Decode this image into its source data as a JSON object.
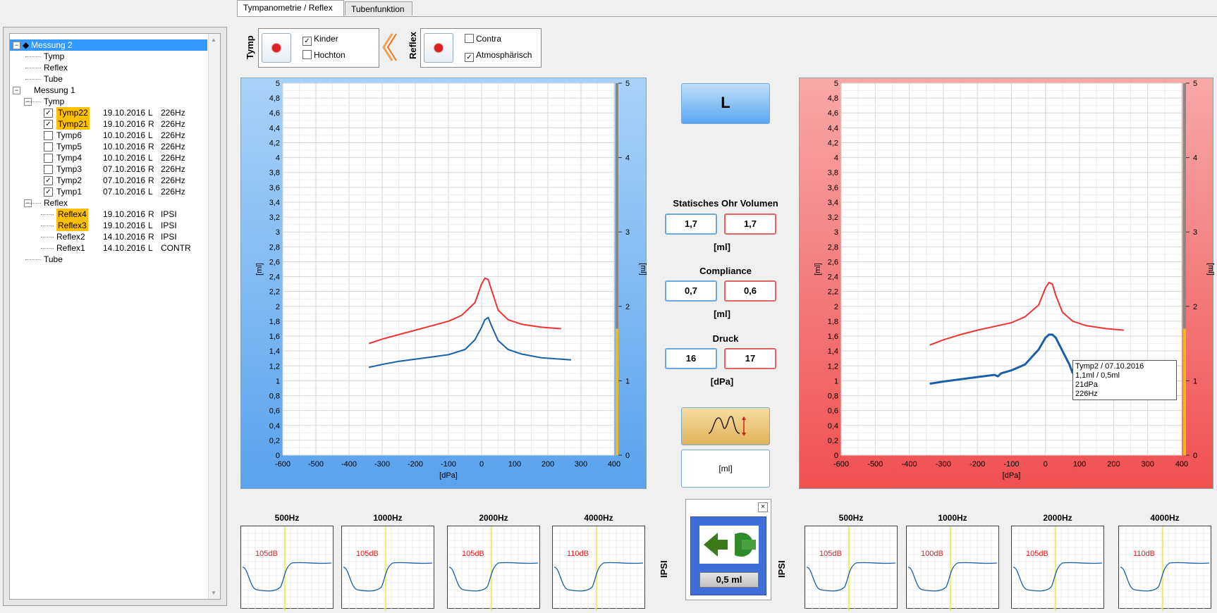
{
  "tabs": [
    "Tympanometrie / Reflex",
    "Tubenfunktion"
  ],
  "tree": {
    "rows": [
      {
        "label": "Messung 2",
        "level": 0,
        "expander": "−",
        "selected": true,
        "diamond": true
      },
      {
        "label": "Tymp",
        "level": 2
      },
      {
        "label": "Reflex",
        "level": 2
      },
      {
        "label": "Tube",
        "level": 2
      },
      {
        "label": "Messung 1",
        "level": 1,
        "expander": "−"
      },
      {
        "label": "Tymp",
        "level": 2,
        "expander": "−"
      },
      {
        "label": "Tymp22",
        "level": 3,
        "checked": true,
        "highlight": true,
        "date": "19.10.2016",
        "side": "L",
        "info": "226Hz"
      },
      {
        "label": "Tymp21",
        "level": 3,
        "checked": true,
        "highlight": true,
        "date": "19.10.2016",
        "side": "R",
        "info": "226Hz"
      },
      {
        "label": "Tymp6",
        "level": 3,
        "checked": false,
        "date": "10.10.2016",
        "side": "L",
        "info": "226Hz"
      },
      {
        "label": "Tymp5",
        "level": 3,
        "checked": false,
        "date": "10.10.2016",
        "side": "R",
        "info": "226Hz"
      },
      {
        "label": "Tymp4",
        "level": 3,
        "checked": false,
        "date": "10.10.2016",
        "side": "L",
        "info": "226Hz"
      },
      {
        "label": "Tymp3",
        "level": 3,
        "checked": false,
        "date": "07.10.2016",
        "side": "R",
        "info": "226Hz"
      },
      {
        "label": "Tymp2",
        "level": 3,
        "checked": true,
        "date": "07.10.2016",
        "side": "R",
        "info": "226Hz"
      },
      {
        "label": "Tymp1",
        "level": 3,
        "checked": true,
        "date": "07.10.2016",
        "side": "L",
        "info": "226Hz"
      },
      {
        "label": "Reflex",
        "level": 2,
        "expander": "−"
      },
      {
        "label": "Reflex4",
        "level": 3,
        "highlight": true,
        "date": "19.10.2016",
        "side": "R",
        "info": "IPSI"
      },
      {
        "label": "Reflex3",
        "level": 3,
        "highlight": true,
        "date": "19.10.2016",
        "side": "L",
        "info": "IPSI"
      },
      {
        "label": "Reflex2",
        "level": 3,
        "date": "14.10.2016",
        "side": "R",
        "info": "IPSI"
      },
      {
        "label": "Reflex1",
        "level": 3,
        "date": "14.10.2016",
        "side": "L",
        "info": "CONTR"
      },
      {
        "label": "Tube",
        "level": 2
      }
    ]
  },
  "tymp_group": {
    "title": "Tymp",
    "kinder": "Kinder",
    "kinder_checked": true,
    "hochton": "Hochton",
    "hochton_checked": false
  },
  "reflex_group": {
    "title": "Reflex",
    "contra": "Contra",
    "contra_checked": false,
    "atmos": "Atmosphärisch",
    "atmos_checked": true
  },
  "ear_button": "L",
  "measures": {
    "volume_title": "Statisches Ohr Volumen",
    "volume_left": "1,7",
    "volume_right": "1,7",
    "volume_unit": "[ml]",
    "compliance_title": "Compliance",
    "compliance_left": "0,7",
    "compliance_right": "0,6",
    "compliance_unit": "[ml]",
    "druck_title": "Druck",
    "druck_left": "16",
    "druck_right": "17",
    "druck_unit": "[dPa]"
  },
  "ml_button": "[ml]",
  "ipsi_box": {
    "value": "0,5 ml",
    "left_label": "IPSI",
    "right_label": "IPSI"
  },
  "colors": {
    "left_panel": "#7db8f0",
    "right_panel": "#f27070",
    "curve_red": "#ee3333",
    "curve_blue": "#1a5fa8",
    "marker": "#f0b820"
  },
  "tooltip": {
    "line1": "Tymp2 / 07.10.2016",
    "line2": "1,1ml / 0,5ml",
    "line3": "21dPa",
    "line4": "226Hz"
  },
  "chart_data": [
    {
      "type": "line",
      "name": "left-tympanogram",
      "xlabel": "[dPa]",
      "ylabel": "[ml]",
      "ylabel_right": "[ml]",
      "xlim": [
        -600,
        400
      ],
      "ylim": [
        0,
        5
      ],
      "xticks": [
        "-600",
        "-500",
        "-400",
        "-300",
        "-200",
        "-100",
        "0",
        "100",
        "200",
        "300",
        "400"
      ],
      "yticks": [
        "0",
        "0,2",
        "0,4",
        "0,6",
        "0,8",
        "1",
        "1,2",
        "1,4",
        "1,6",
        "1,8",
        "2",
        "2,2",
        "2,4",
        "2,6",
        "2,8",
        "3",
        "3,2",
        "3,4",
        "3,6",
        "3,8",
        "4",
        "4,2",
        "4,4",
        "4,6",
        "4,8",
        "5"
      ],
      "yticks_right": [
        "0",
        "1",
        "2",
        "3",
        "4",
        "5"
      ],
      "series": [
        {
          "color": "#ee3333",
          "x": [
            -340,
            -300,
            -250,
            -200,
            -150,
            -100,
            -60,
            -20,
            0,
            10,
            20,
            30,
            50,
            80,
            120,
            180,
            240
          ],
          "y": [
            1.5,
            1.56,
            1.62,
            1.68,
            1.74,
            1.8,
            1.88,
            2.05,
            2.3,
            2.38,
            2.36,
            2.22,
            1.95,
            1.82,
            1.76,
            1.72,
            1.7
          ]
        },
        {
          "color": "#1a5fa8",
          "x": [
            -340,
            -300,
            -250,
            -200,
            -150,
            -100,
            -50,
            -20,
            0,
            10,
            20,
            30,
            50,
            80,
            120,
            180,
            270
          ],
          "y": [
            1.18,
            1.22,
            1.26,
            1.29,
            1.32,
            1.35,
            1.42,
            1.55,
            1.72,
            1.82,
            1.85,
            1.74,
            1.54,
            1.42,
            1.36,
            1.31,
            1.28
          ]
        }
      ]
    },
    {
      "type": "line",
      "name": "right-tympanogram",
      "xlabel": "[dPa]",
      "ylabel": "[ml]",
      "ylabel_right": "[ml]",
      "xlim": [
        -600,
        400
      ],
      "ylim": [
        0,
        5
      ],
      "xticks": [
        "-600",
        "-500",
        "-400",
        "-300",
        "-200",
        "-100",
        "0",
        "100",
        "200",
        "300",
        "400"
      ],
      "yticks": [
        "0",
        "0,2",
        "0,4",
        "0,6",
        "0,8",
        "1",
        "1,2",
        "1,4",
        "1,6",
        "1,8",
        "2",
        "2,2",
        "2,4",
        "2,6",
        "2,8",
        "3",
        "3,2",
        "3,4",
        "3,6",
        "3,8",
        "4",
        "4,2",
        "4,4",
        "4,6",
        "4,8",
        "5"
      ],
      "yticks_right": [
        "0",
        "1",
        "2",
        "3",
        "4",
        "5"
      ],
      "series": [
        {
          "color": "#ee3333",
          "x": [
            -340,
            -300,
            -250,
            -200,
            -150,
            -100,
            -60,
            -20,
            0,
            10,
            20,
            30,
            50,
            80,
            120,
            180,
            230
          ],
          "y": [
            1.48,
            1.55,
            1.62,
            1.68,
            1.73,
            1.78,
            1.86,
            2.02,
            2.25,
            2.32,
            2.3,
            2.15,
            1.92,
            1.8,
            1.74,
            1.7,
            1.68
          ]
        },
        {
          "color": "#1a5fa8",
          "x": [
            -340,
            -300,
            -250,
            -200,
            -150,
            -140,
            -130,
            -100,
            -60,
            -20,
            0,
            10,
            20,
            30,
            50,
            70,
            80
          ],
          "y": [
            0.96,
            0.99,
            1.02,
            1.05,
            1.08,
            1.06,
            1.1,
            1.14,
            1.22,
            1.42,
            1.58,
            1.62,
            1.62,
            1.58,
            1.4,
            1.22,
            1.1
          ]
        }
      ]
    }
  ],
  "reflex_left": [
    {
      "freq": "500Hz",
      "level": "105dB"
    },
    {
      "freq": "1000Hz",
      "level": "105dB"
    },
    {
      "freq": "2000Hz",
      "level": "105dB"
    },
    {
      "freq": "4000Hz",
      "level": "110dB"
    }
  ],
  "reflex_right": [
    {
      "freq": "500Hz",
      "level": "105dB"
    },
    {
      "freq": "1000Hz",
      "level": "100dB"
    },
    {
      "freq": "2000Hz",
      "level": "105dB"
    },
    {
      "freq": "4000Hz",
      "level": "110dB"
    }
  ]
}
